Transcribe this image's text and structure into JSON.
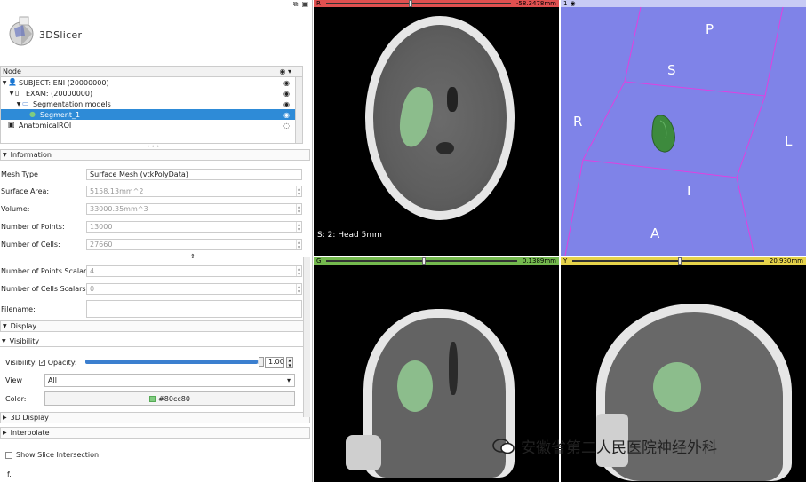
{
  "app": {
    "name": "3DSlicer"
  },
  "tree": {
    "header": "Node",
    "rows": [
      {
        "label": "SUBJECT: ENI (20000000)",
        "icon": "person-icon"
      },
      {
        "label": "EXAM: (20000000)",
        "icon": "study-icon"
      },
      {
        "label": "Segmentation models",
        "icon": "folder-icon"
      },
      {
        "label": "Segment_1",
        "icon": "segment-icon"
      },
      {
        "label": "AnatomicalROI",
        "icon": "roi-icon"
      }
    ]
  },
  "info": {
    "section_title": "Information",
    "fields": [
      {
        "label": "Mesh Type",
        "value": "Surface Mesh (vtkPolyData)"
      },
      {
        "label": "Surface Area:",
        "value": "5158.13mm^2"
      },
      {
        "label": "Volume:",
        "value": "33000.35mm^3"
      },
      {
        "label": "Number of Points:",
        "value": "13000"
      },
      {
        "label": "Number of Cells:",
        "value": "27660"
      },
      {
        "label": "Number of Points Scalars:",
        "value": "4"
      },
      {
        "label": "Number of Cells Scalars:",
        "value": "0"
      },
      {
        "label": "Filename:",
        "value": ""
      }
    ]
  },
  "display": {
    "section_title": "Display",
    "visibility_title": "Visibility",
    "visibility_label": "Visibility:",
    "opacity_label": "Opacity:",
    "opacity_value": "1.00",
    "opacity_fraction": 0.98,
    "view_label": "View",
    "view_value": "All",
    "color_label": "Color:",
    "color_value": "#80cc80",
    "overlay_title": "3D Display",
    "interpolate_title": "Interpolate",
    "show_slice_label": "Show Slice Intersection",
    "footer": "f."
  },
  "views": {
    "red": {
      "tag": "R",
      "value": "-58.3478mm",
      "slider": 0.45,
      "label": "S: 2: Head 5mm",
      "color": "#e05050"
    },
    "green": {
      "tag": "G",
      "value": "0.1389mm",
      "slider": 0.5,
      "color": "#74b94e"
    },
    "yellow": {
      "tag": "Y",
      "value": "20.930mm",
      "slider": 0.55,
      "color": "#e6d34a"
    },
    "three_d": {
      "tag": "1",
      "bg": "#7f83e8",
      "labels": {
        "P": "P",
        "S": "S",
        "R": "R",
        "L": "L",
        "I": "I",
        "A": "A"
      }
    }
  },
  "watermark": {
    "text": "安徽省第二人民医院神经外科"
  }
}
